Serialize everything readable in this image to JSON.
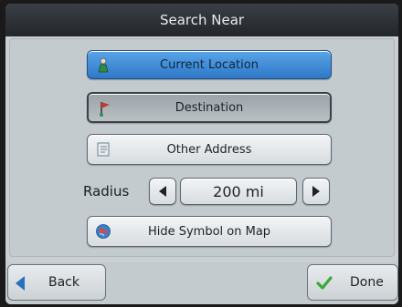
{
  "title": "Search Near",
  "options": [
    {
      "label": "Current Location",
      "icon": "person-location-icon",
      "state": "selected"
    },
    {
      "label": "Destination",
      "icon": "destination-flag-icon",
      "state": "pressed"
    },
    {
      "label": "Other Address",
      "icon": "address-book-icon",
      "state": "normal"
    }
  ],
  "radius": {
    "label": "Radius",
    "value": "200 mi"
  },
  "hide_symbol": {
    "label": "Hide Symbol on Map",
    "icon": "globe-map-icon"
  },
  "footer": {
    "back_label": "Back",
    "done_label": "Done"
  },
  "colors": {
    "accent": "#3f8ad8",
    "check": "#3aa83a",
    "back_arrow": "#2a6fc0"
  }
}
